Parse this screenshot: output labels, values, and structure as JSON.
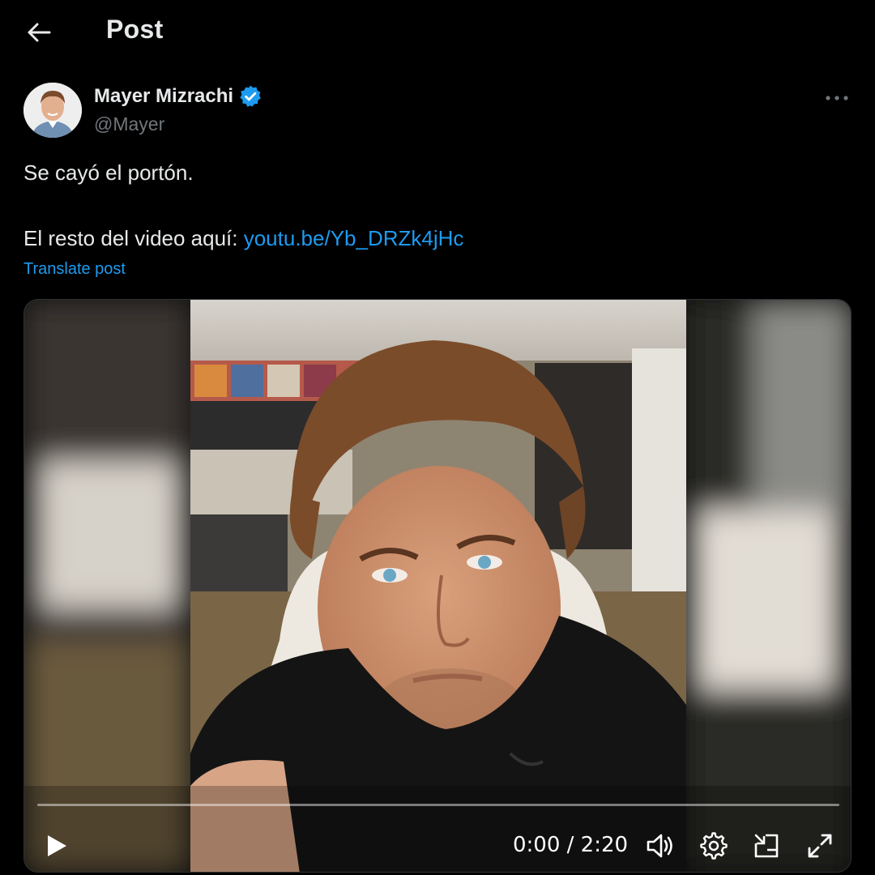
{
  "header": {
    "title": "Post",
    "back_icon": "arrow-left-icon"
  },
  "author": {
    "display_name": "Mayer Mizrachi",
    "handle": "@Mayer",
    "verified": true,
    "verified_color": "#1d9bf0"
  },
  "post": {
    "line1": "Se cayó el portón.",
    "line2_prefix": "El resto del video aquí: ",
    "link_text": "youtu.be/Yb_DRZk4jHc",
    "translate_label": "Translate post"
  },
  "video": {
    "time_display": "0:00 / 2:20",
    "progress": 0,
    "controls": [
      "play-icon",
      "volume-icon",
      "gear-icon",
      "picture-in-picture-icon",
      "fullscreen-icon"
    ]
  },
  "colors": {
    "background": "#000000",
    "text": "#e7e9ea",
    "muted": "#71767b",
    "accent": "#1d9bf0"
  }
}
